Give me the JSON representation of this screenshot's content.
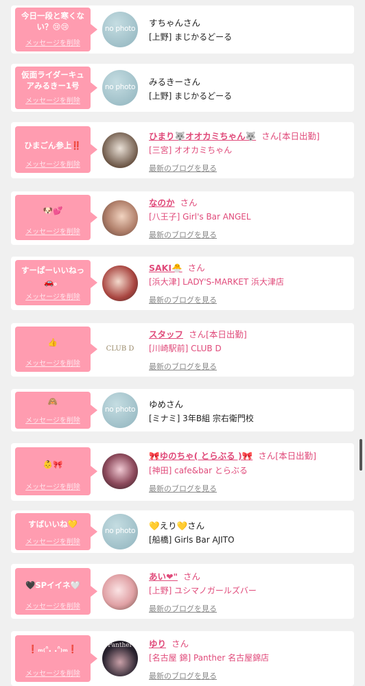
{
  "delete_label": "メッセージを削除",
  "blog_label": "最新のブログを見る",
  "colors": {
    "bubble": "#ff9cb0",
    "accent": "#e04a7a"
  },
  "items": [
    {
      "message": "今日一段と寒くない？😢😢",
      "message_lines": [
        "今日一段と寒くな",
        "い？😢😢"
      ],
      "name": "すちゃん",
      "san": "さん",
      "shop": "[上野] まじかるどーる",
      "link": false,
      "avatar": "no photo"
    },
    {
      "message": "仮面ライダーキュアみるきー1号",
      "message_lines": [
        "仮面ライダーキュ",
        "アみるきー1号"
      ],
      "name": "みるきー",
      "san": "さん",
      "shop": "[上野] まじかるどーる",
      "link": false,
      "avatar": "no photo"
    },
    {
      "message": "ひまごん参上‼️",
      "message_lines": [
        "ひまごん参上‼️"
      ],
      "name": "ひまり🐺オオカミちゃん🐺",
      "san": "さん",
      "status": "[本日出勤]",
      "shop": "[三宮] オオカミちゃん",
      "link": true
    },
    {
      "message": "🐶💕",
      "message_lines": [
        "🐶💕"
      ],
      "name": "なのか",
      "san": "さん",
      "shop": "[八王子] Girl's Bar ANGEL",
      "link": true
    },
    {
      "message": "すーぱーいいねっ🚗。",
      "message_lines": [
        "すーぱーいいねっ",
        "🚗。"
      ],
      "name": "SAKI🐣",
      "san": "さん",
      "shop": "[浜大津] LADY'S-MARKET 浜大津店",
      "link": true
    },
    {
      "message": "👍",
      "message_lines": [
        "👍"
      ],
      "name": "スタッフ",
      "san": "さん",
      "status": "[本日出勤]",
      "shop": "[川崎駅前] CLUB D",
      "link": true,
      "avatar_text": "CLUB D"
    },
    {
      "message": "🙈",
      "message_lines": [
        "🙈"
      ],
      "name": "ゆめ",
      "san": "さん",
      "shop": "[ミナミ] 3年B組 宗右衛門校",
      "link": false,
      "avatar": "no photo"
    },
    {
      "message": "👶🎀",
      "message_lines": [
        "👶🎀"
      ],
      "name": "🎀ゆのちゃ( とらぶる )🎀",
      "san": "さん",
      "status": "[本日出勤]",
      "shop": "[神田] cafe&bar とらぶる",
      "link": true
    },
    {
      "message": "すばいいね💛",
      "message_lines": [
        "すばいいね💛"
      ],
      "name": "💛えり💛",
      "san": "さん",
      "shop": "[船橋] Girls Bar AJITO",
      "link": false,
      "avatar": "no photo"
    },
    {
      "message": "🖤SPイイネ🤍",
      "message_lines": [
        "🖤SPイイネ🤍"
      ],
      "name": "あい❤\"",
      "san": "さん",
      "shop": "[上野] ユシマノガールズバー",
      "link": true
    },
    {
      "message": "❗ₘ₍ᐢ. .ᐢ₎ₘ❗",
      "message_lines": [
        "❗ₘ₍ᐢ. .ᐢ₎ₘ❗"
      ],
      "name": "ゆり",
      "san": "さん",
      "shop": "[名古屋 錦] Panther 名古屋錦店",
      "link": true,
      "avatar_text": "Panther"
    }
  ]
}
